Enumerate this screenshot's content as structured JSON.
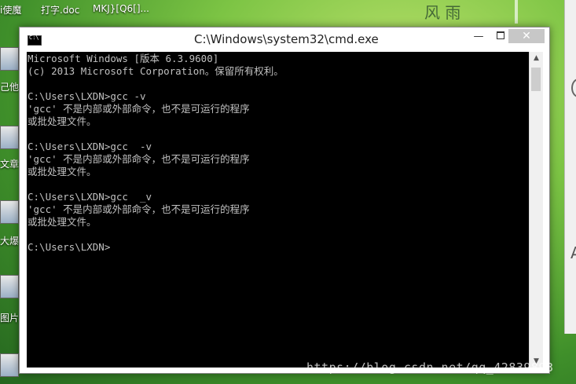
{
  "desktop": {
    "top_labels": [
      "i使魔",
      "打字.doc",
      "MKJ}[Q6[]..."
    ],
    "side_labels": [
      "己他",
      "文章",
      "大爆",
      "图片"
    ]
  },
  "window": {
    "title": "C:\\Windows\\system32\\cmd.exe",
    "icon_glyph": "C:\\",
    "minimize_glyph": "—",
    "close_glyph": "✕"
  },
  "console_lines": [
    "Microsoft Windows [版本 6.3.9600]",
    "(c) 2013 Microsoft Corporation。保留所有权利。",
    "",
    "C:\\Users\\LXDN>gcc -v",
    "'gcc' 不是内部或外部命令，也不是可运行的程序",
    "或批处理文件。",
    "",
    "C:\\Users\\LXDN>gcc  -v",
    "'gcc' 不是内部或外部命令，也不是可运行的程序",
    "或批处理文件。",
    "",
    "C:\\Users\\LXDN>gcc  _v",
    "'gcc' 不是内部或外部命令，也不是可运行的程序",
    "或批处理文件。",
    "",
    "C:\\Users\\LXDN>"
  ],
  "scrollbar": {
    "up_glyph": "▲",
    "down_glyph": "▼"
  },
  "watermark": "https://blog.csdn.net/qq_42839893",
  "background_chars": "风 雨",
  "right_panel_glyph": "A"
}
